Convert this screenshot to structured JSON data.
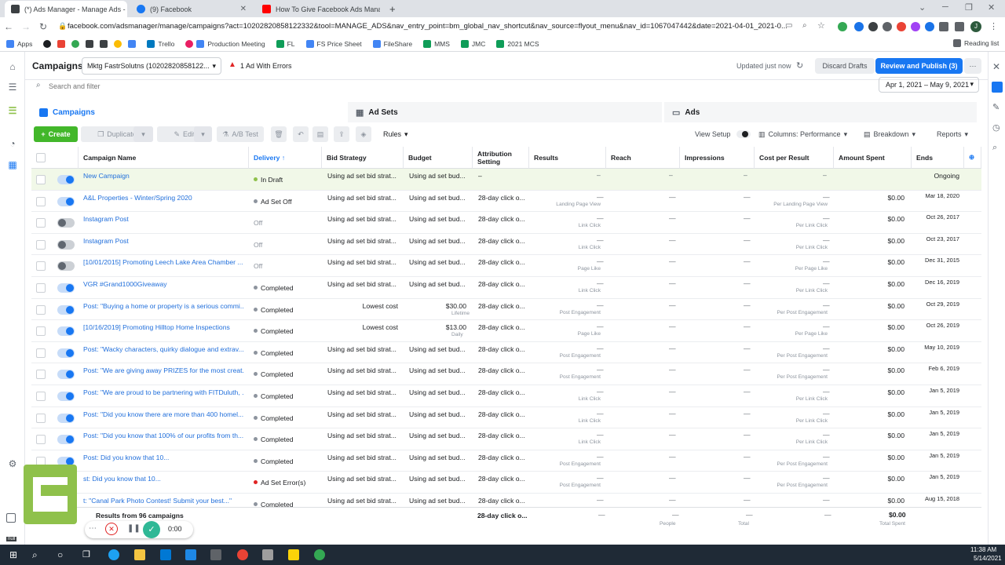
{
  "browser": {
    "tabs": [
      {
        "title": "(*) Ads Manager - Manage Ads -",
        "favicon_color": "#3c4043"
      },
      {
        "title": "(9) Facebook",
        "favicon_color": "#1877f2"
      },
      {
        "title": "How To Give Facebook Ads Mana",
        "favicon_color": "#ff0000"
      }
    ],
    "new_tab": "+",
    "url": "facebook.com/adsmanager/manage/campaigns?act=10202820858122332&tool=MANAGE_ADS&nav_entry_point=bm_global_nav_shortcut&nav_source=flyout_menu&nav_id=1067047442&date=2021-04-01_2021-0...",
    "profile_initial": "J",
    "bookmarks": [
      {
        "label": "Apps",
        "color": "#4285f4"
      },
      {
        "label": "Trello",
        "color": "#0079bf"
      },
      {
        "label": "Production Meeting",
        "color": "#4285f4"
      },
      {
        "label": "FL",
        "color": "#0f9d58"
      },
      {
        "label": "FS Price Sheet",
        "color": "#4285f4"
      },
      {
        "label": "FileShare",
        "color": "#4285f4"
      },
      {
        "label": "MMS",
        "color": "#0f9d58"
      },
      {
        "label": "JMC",
        "color": "#0f9d58"
      },
      {
        "label": "2021 MCS",
        "color": "#0f9d58"
      }
    ],
    "reading_list": "Reading list"
  },
  "topbar": {
    "title": "Campaigns",
    "account": "Mktg FastrSolutns (10202820858122...",
    "errors": "1 Ad With Errors",
    "updated": "Updated just now",
    "discard": "Discard Drafts",
    "review": "Review and Publish (3)",
    "more": "···"
  },
  "search": {
    "placeholder": "Search and filter",
    "date_range": "Apr 1, 2021 – May 9, 2021"
  },
  "level_tabs": {
    "campaigns": "Campaigns",
    "adsets": "Ad Sets",
    "ads": "Ads"
  },
  "toolbar": {
    "create": "Create",
    "duplicate": "Duplicate",
    "edit": "Edit",
    "ab_test": "A/B Test",
    "rules": "Rules",
    "view_setup": "View Setup",
    "columns": "Columns: Performance",
    "breakdown": "Breakdown",
    "reports": "Reports"
  },
  "table": {
    "headers": [
      "Campaign Name",
      "Delivery ↑",
      "Bid Strategy",
      "Budget",
      "Attribution Setting",
      "Results",
      "Reach",
      "Impressions",
      "Cost per Result",
      "Amount Spent",
      "Ends"
    ],
    "rows": [
      {
        "name": "New Campaign",
        "delivery": "In Draft",
        "dot": "#8fc14b",
        "toggle": "on",
        "bid": "Using ad set bid strat...",
        "budget": "Using ad set bud...",
        "budget_sub": "",
        "attr": "–",
        "results": "–",
        "results_sub": "",
        "reach": "–",
        "impr": "–",
        "cpr": "–",
        "cpr_sub": "",
        "spent": "",
        "ends": "Ongoing",
        "draft": true
      },
      {
        "name": "A&L Properties - Winter/Spring 2020",
        "delivery": "Ad Set Off",
        "dot": "#8d949e",
        "toggle": "on",
        "bid": "Using ad set bid strat...",
        "budget": "Using ad set bud...",
        "budget_sub": "",
        "attr": "28-day click o...",
        "results": "—",
        "results_sub": "Landing Page View",
        "reach": "—",
        "impr": "—",
        "cpr": "—",
        "cpr_sub": "Per Landing Page View",
        "spent": "$0.00",
        "ends": "Mar 18, 2020"
      },
      {
        "name": "Instagram Post",
        "delivery": "Off",
        "dot": "",
        "toggle": "off",
        "bid": "Using ad set bid strat...",
        "budget": "Using ad set bud...",
        "budget_sub": "",
        "attr": "28-day click o...",
        "results": "—",
        "results_sub": "Link Click",
        "reach": "—",
        "impr": "—",
        "cpr": "—",
        "cpr_sub": "Per Link Click",
        "spent": "$0.00",
        "ends": "Oct 26, 2017"
      },
      {
        "name": "Instagram Post",
        "delivery": "Off",
        "dot": "",
        "toggle": "off",
        "bid": "Using ad set bid strat...",
        "budget": "Using ad set bud...",
        "budget_sub": "",
        "attr": "28-day click o...",
        "results": "—",
        "results_sub": "Link Click",
        "reach": "—",
        "impr": "—",
        "cpr": "—",
        "cpr_sub": "Per Link Click",
        "spent": "$0.00",
        "ends": "Oct 23, 2017"
      },
      {
        "name": "[10/01/2015] Promoting Leech Lake Area Chamber ...",
        "delivery": "Off",
        "dot": "",
        "toggle": "off",
        "bid": "Using ad set bid strat...",
        "budget": "Using ad set bud...",
        "budget_sub": "",
        "attr": "28-day click o...",
        "results": "—",
        "results_sub": "Page Like",
        "reach": "—",
        "impr": "—",
        "cpr": "—",
        "cpr_sub": "Per Page Like",
        "spent": "$0.00",
        "ends": "Dec 31, 2015"
      },
      {
        "name": "VGR #Grand1000Giveaway",
        "delivery": "Completed",
        "dot": "#8d949e",
        "toggle": "on",
        "bid": "Using ad set bid strat...",
        "budget": "Using ad set bud...",
        "budget_sub": "",
        "attr": "28-day click o...",
        "results": "—",
        "results_sub": "Link Click",
        "reach": "—",
        "impr": "—",
        "cpr": "—",
        "cpr_sub": "Per Link Click",
        "spent": "$0.00",
        "ends": "Dec 16, 2019"
      },
      {
        "name": "Post: \"Buying a home or property is a serious commi...",
        "delivery": "Completed",
        "dot": "#8d949e",
        "toggle": "on",
        "bid": "Lowest cost",
        "budget": "$30.00",
        "budget_sub": "Lifetime",
        "attr": "28-day click o...",
        "results": "—",
        "results_sub": "Post Engagement",
        "reach": "—",
        "impr": "—",
        "cpr": "—",
        "cpr_sub": "Per Post Engagement",
        "spent": "$0.00",
        "ends": "Oct 29, 2019"
      },
      {
        "name": "[10/16/2019] Promoting Hilltop Home Inspections",
        "delivery": "Completed",
        "dot": "#8d949e",
        "toggle": "on",
        "bid": "Lowest cost",
        "budget": "$13.00",
        "budget_sub": "Daily",
        "attr": "28-day click o...",
        "results": "—",
        "results_sub": "Page Like",
        "reach": "—",
        "impr": "—",
        "cpr": "—",
        "cpr_sub": "Per Page Like",
        "spent": "$0.00",
        "ends": "Oct 26, 2019"
      },
      {
        "name": "Post: \"Wacky characters, quirky dialogue and extrav...",
        "delivery": "Completed",
        "dot": "#8d949e",
        "toggle": "on",
        "bid": "Using ad set bid strat...",
        "budget": "Using ad set bud...",
        "budget_sub": "",
        "attr": "28-day click o...",
        "results": "—",
        "results_sub": "Post Engagement",
        "reach": "—",
        "impr": "—",
        "cpr": "—",
        "cpr_sub": "Per Post Engagement",
        "spent": "$0.00",
        "ends": "May 10, 2019"
      },
      {
        "name": "Post: \"We are giving away PRIZES for the most creat...",
        "delivery": "Completed",
        "dot": "#8d949e",
        "toggle": "on",
        "bid": "Using ad set bid strat...",
        "budget": "Using ad set bud...",
        "budget_sub": "",
        "attr": "28-day click o...",
        "results": "—",
        "results_sub": "Post Engagement",
        "reach": "—",
        "impr": "—",
        "cpr": "—",
        "cpr_sub": "Per Post Engagement",
        "spent": "$0.00",
        "ends": "Feb 6, 2019"
      },
      {
        "name": "Post: \"We are proud to be partnering with FITDuluth, ...",
        "delivery": "Completed",
        "dot": "#8d949e",
        "toggle": "on",
        "bid": "Using ad set bid strat...",
        "budget": "Using ad set bud...",
        "budget_sub": "",
        "attr": "28-day click o...",
        "results": "—",
        "results_sub": "Link Click",
        "reach": "—",
        "impr": "—",
        "cpr": "—",
        "cpr_sub": "Per Link Click",
        "spent": "$0.00",
        "ends": "Jan 5, 2019"
      },
      {
        "name": "Post: \"Did you know there are more than 400 homel...",
        "delivery": "Completed",
        "dot": "#8d949e",
        "toggle": "on",
        "bid": "Using ad set bid strat...",
        "budget": "Using ad set bud...",
        "budget_sub": "",
        "attr": "28-day click o...",
        "results": "—",
        "results_sub": "Link Click",
        "reach": "—",
        "impr": "—",
        "cpr": "—",
        "cpr_sub": "Per Link Click",
        "spent": "$0.00",
        "ends": "Jan 5, 2019"
      },
      {
        "name": "Post: \"Did you know that 100% of our profits from th...",
        "delivery": "Completed",
        "dot": "#8d949e",
        "toggle": "on",
        "bid": "Using ad set bid strat...",
        "budget": "Using ad set bud...",
        "budget_sub": "",
        "attr": "28-day click o...",
        "results": "—",
        "results_sub": "Link Click",
        "reach": "—",
        "impr": "—",
        "cpr": "—",
        "cpr_sub": "Per Link Click",
        "spent": "$0.00",
        "ends": "Jan 5, 2019"
      },
      {
        "name": "Post: Did you know that 10...",
        "delivery": "Completed",
        "dot": "#8d949e",
        "toggle": "on",
        "bid": "Using ad set bid strat...",
        "budget": "Using ad set bud...",
        "budget_sub": "",
        "attr": "28-day click o...",
        "results": "—",
        "results_sub": "Post Engagement",
        "reach": "—",
        "impr": "—",
        "cpr": "—",
        "cpr_sub": "Per Post Engagement",
        "spent": "$0.00",
        "ends": "Jan 5, 2019"
      },
      {
        "name": "st: Did you know that 10...",
        "delivery": "Ad Set Error(s)",
        "dot": "#e02424",
        "toggle": "on",
        "bid": "Using ad set bid strat...",
        "budget": "Using ad set bud...",
        "budget_sub": "",
        "attr": "28-day click o...",
        "results": "—",
        "results_sub": "Post Engagement",
        "reach": "—",
        "impr": "—",
        "cpr": "—",
        "cpr_sub": "Per Post Engagement",
        "spent": "$0.00",
        "ends": "Jan 5, 2019"
      },
      {
        "name": "t: \"Canal Park Photo Contest! Submit your best...\"",
        "delivery": "Completed",
        "dot": "#8d949e",
        "toggle": "on",
        "bid": "Using ad set bid strat...",
        "budget": "Using ad set bud...",
        "budget_sub": "",
        "attr": "28-day click o...",
        "results": "—",
        "results_sub": "",
        "reach": "—",
        "impr": "—",
        "cpr": "—",
        "cpr_sub": "",
        "spent": "$0.00",
        "ends": "Aug 15, 2018"
      }
    ],
    "totals": {
      "label": "Results from 96 campaigns",
      "attr": "28-day click o...",
      "results": "—",
      "reach": "—",
      "reach_sub": "People",
      "impr": "—",
      "impr_sub": "Total",
      "cpr": "—",
      "spent": "$0.00",
      "spent_sub": "Total Spent"
    }
  },
  "recorder": {
    "time": "0:00",
    "null_label": "null"
  },
  "taskbar": {
    "time": "11:38 AM",
    "date": "5/14/2021"
  }
}
